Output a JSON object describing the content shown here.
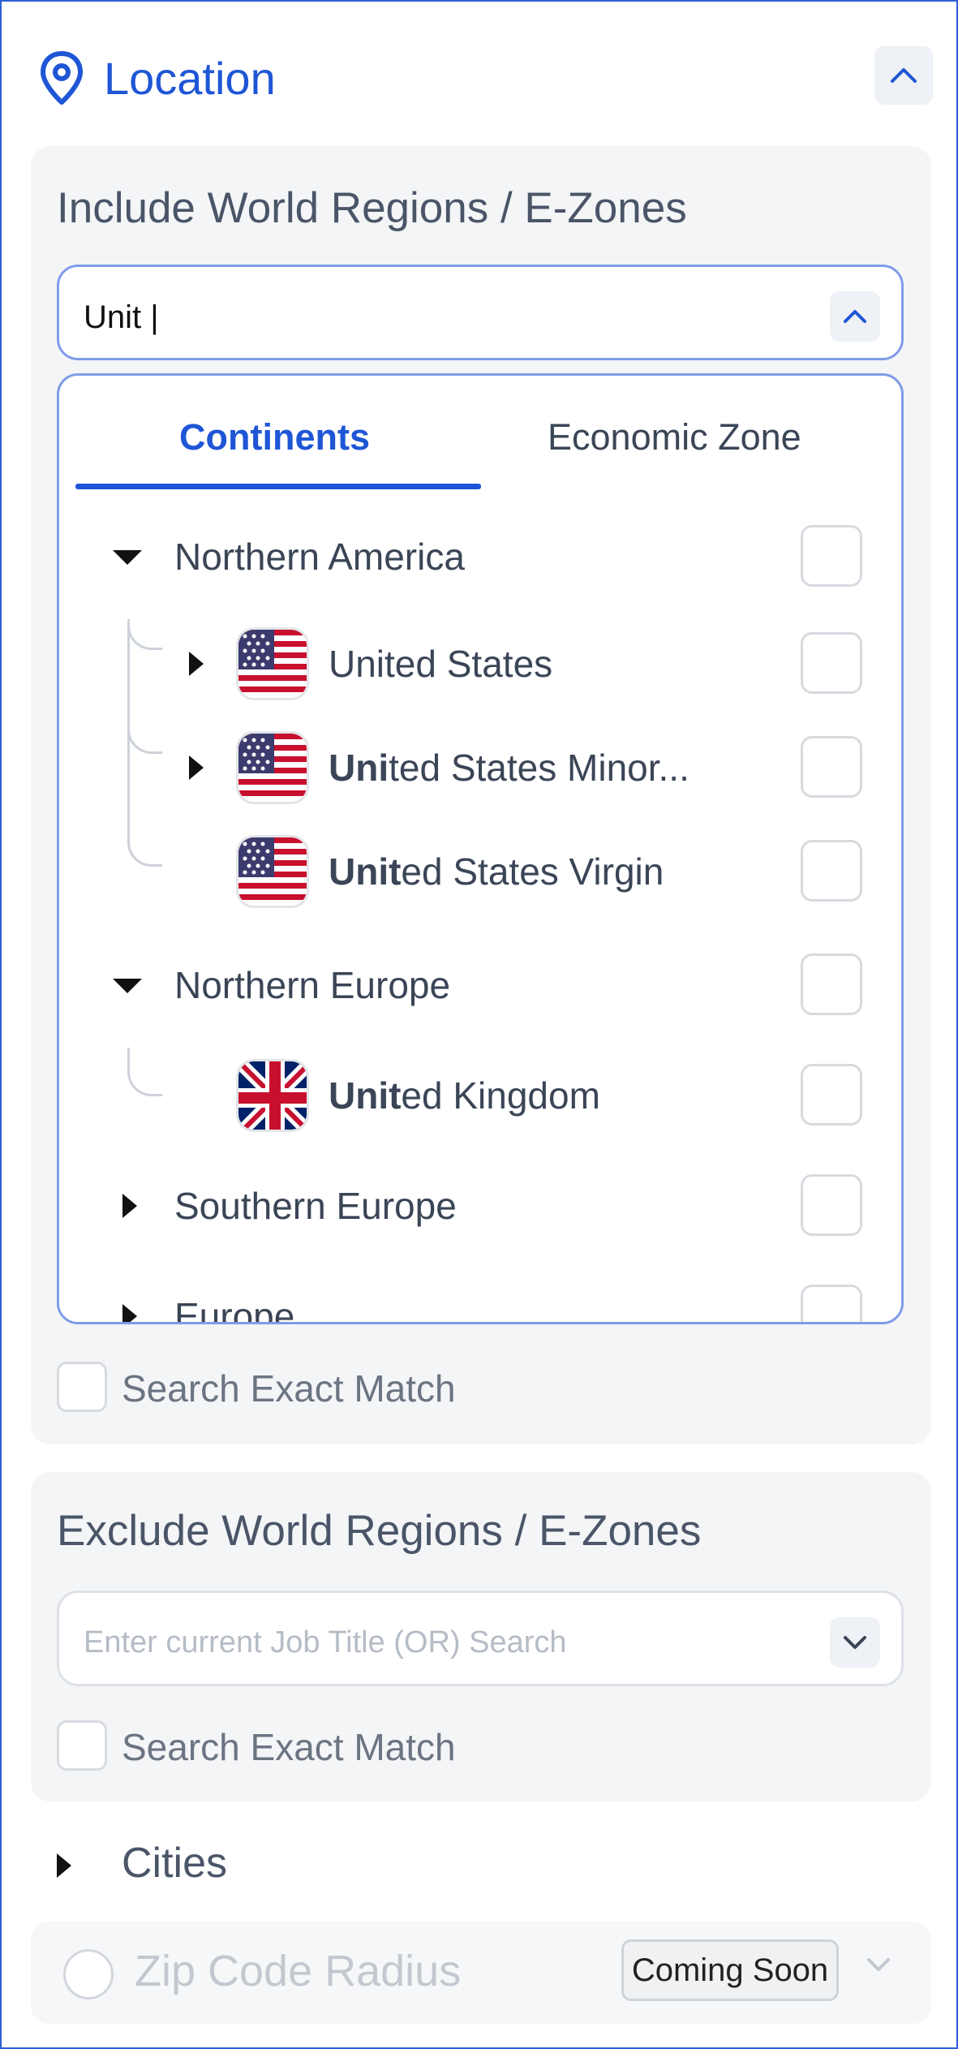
{
  "location": {
    "title": "Location",
    "icon": "map-pin-icon",
    "accent": "#1f56d6"
  },
  "include": {
    "title": "Include World Regions / E-Zones",
    "input_value": "Unit |",
    "tabs": [
      {
        "label": "Continents",
        "active": true
      },
      {
        "label": "Economic Zone",
        "active": false
      }
    ],
    "tree": [
      {
        "label": "Northern America",
        "expanded": true,
        "level": 0
      },
      {
        "label": "United States",
        "match": "",
        "rest": "United States",
        "flag": "us-flag",
        "level": 1,
        "expandable": true
      },
      {
        "label": "United States Minor...",
        "match": "Uni",
        "rest": "ted States Minor...",
        "flag": "us-flag",
        "level": 1,
        "expandable": true
      },
      {
        "label": "United States Virgin",
        "match": "Unit",
        "rest": "ed States Virgin",
        "flag": "us-flag",
        "level": 1,
        "expandable": false
      },
      {
        "label": "Northern Europe",
        "expanded": true,
        "level": 0
      },
      {
        "label": "United Kingdom",
        "match": "Unit",
        "rest": "ed Kingdom",
        "flag": "uk-flag",
        "level": 1,
        "expandable": false
      },
      {
        "label": "Southern Europe",
        "expanded": false,
        "level": 0
      },
      {
        "label": "Europe",
        "expanded": false,
        "level": 0
      }
    ],
    "exact_match_label": "Search Exact Match"
  },
  "exclude": {
    "title": "Exclude World Regions / E-Zones",
    "placeholder": "Enter current Job Title (OR) Search",
    "exact_match_label": "Search Exact Match"
  },
  "cities": {
    "label": "Cities"
  },
  "zip": {
    "label": "Zip Code Radius",
    "badge": "Coming Soon"
  }
}
